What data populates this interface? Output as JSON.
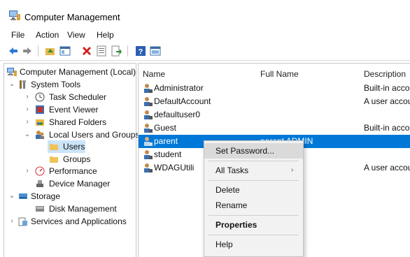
{
  "window": {
    "title": "Computer Management"
  },
  "menu": [
    "File",
    "Action",
    "View",
    "Help"
  ],
  "toolbar": {
    "buttons": [
      "back-arrow-icon",
      "forward-arrow-icon",
      "up-folder-icon",
      "show-hide-tree-icon",
      "delete-icon",
      "properties-icon",
      "export-list-icon",
      "help-icon",
      "view-icon"
    ]
  },
  "tree": {
    "items": [
      {
        "label": "Computer Management (Local)",
        "icon": "computer-management-icon"
      },
      {
        "label": "System Tools",
        "icon": "tools-icon",
        "expanded": true
      },
      {
        "label": "Task Scheduler",
        "icon": "clock-icon"
      },
      {
        "label": "Event Viewer",
        "icon": "event-viewer-icon"
      },
      {
        "label": "Shared Folders",
        "icon": "shared-folder-icon"
      },
      {
        "label": "Local Users and Groups",
        "icon": "users-group-icon",
        "expanded": true
      },
      {
        "label": "Users",
        "icon": "folder-icon",
        "selected": true
      },
      {
        "label": "Groups",
        "icon": "folder-icon"
      },
      {
        "label": "Performance",
        "icon": "performance-icon"
      },
      {
        "label": "Device Manager",
        "icon": "device-manager-icon"
      },
      {
        "label": "Storage",
        "icon": "storage-icon",
        "expanded": true
      },
      {
        "label": "Disk Management",
        "icon": "disk-icon"
      },
      {
        "label": "Services and Applications",
        "icon": "services-icon"
      }
    ]
  },
  "list": {
    "columns": [
      "Name",
      "Full Name",
      "Description"
    ],
    "rows": [
      {
        "name": "Administrator",
        "full_name": "",
        "description": "Built-in accou"
      },
      {
        "name": "DefaultAccount",
        "full_name": "",
        "description": "A user accoun"
      },
      {
        "name": "defaultuser0",
        "full_name": "",
        "description": ""
      },
      {
        "name": "Guest",
        "full_name": "",
        "description": "Built-in accou"
      },
      {
        "name": "parent",
        "full_name": "parent ADMIN",
        "description": "",
        "selected": true
      },
      {
        "name": "student",
        "full_name": "R",
        "description": ""
      },
      {
        "name": "WDAGUtili",
        "full_name": "",
        "description": "A user accoun"
      }
    ]
  },
  "context_menu": {
    "items": [
      {
        "label": "Set Password...",
        "highlighted": true
      },
      {
        "label": "All Tasks",
        "submenu": true
      },
      {
        "label": "Delete"
      },
      {
        "label": "Rename"
      },
      {
        "label": "Properties",
        "bold": true
      },
      {
        "label": "Help"
      }
    ]
  },
  "colors": {
    "selection": "#0078d7",
    "tree_selection": "#cce4f7"
  }
}
